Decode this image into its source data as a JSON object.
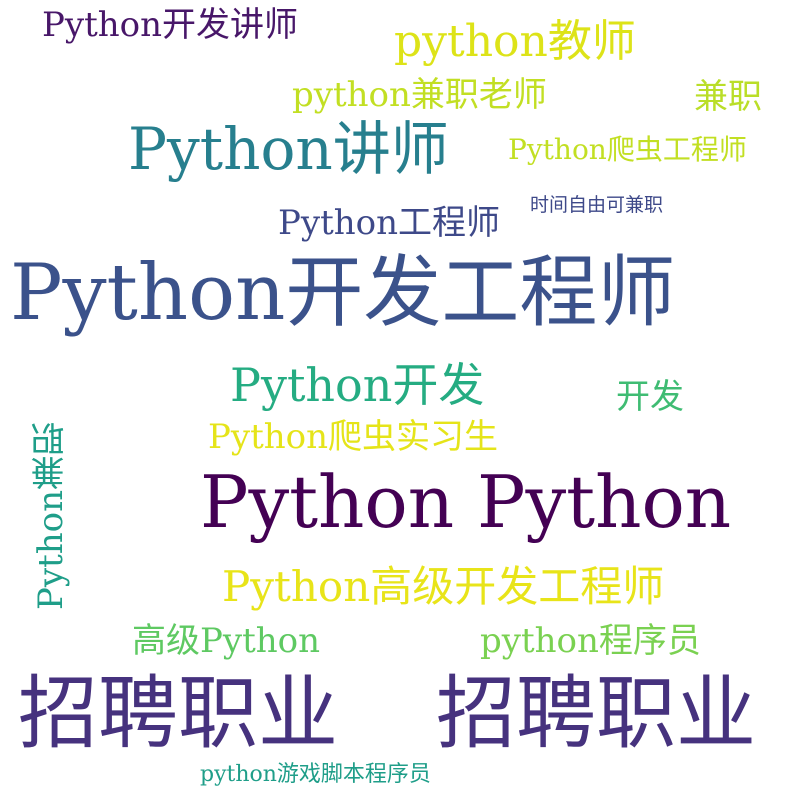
{
  "words": [
    {
      "id": "python-python",
      "text": "Python Python",
      "color": "#440154"
    },
    {
      "id": "python-dev-engineer",
      "text": "Python开发工程师",
      "color": "#3b528b"
    },
    {
      "id": "recruit-1",
      "text": "招聘职业",
      "color": "#46327e"
    },
    {
      "id": "recruit-2",
      "text": "招聘职业",
      "color": "#46327e"
    },
    {
      "id": "python-lecturer",
      "text": "Python讲师",
      "color": "#277f8e"
    },
    {
      "id": "python-teacher",
      "text": "python教师",
      "color": "#dde318"
    },
    {
      "id": "python-dev-lecturer",
      "text": "Python开发讲师",
      "color": "#481769"
    },
    {
      "id": "python-parttime-teacher",
      "text": "python兼职老师",
      "color": "#c2df23"
    },
    {
      "id": "parttime",
      "text": "兼职",
      "color": "#bade28"
    },
    {
      "id": "python-crawler-engineer",
      "text": "Python爬虫工程师",
      "color": "#c2df23"
    },
    {
      "id": "python-engineer",
      "text": "Python工程师",
      "color": "#3e4989"
    },
    {
      "id": "flexible-time",
      "text": "时间自由可兼职",
      "color": "#3e4989"
    },
    {
      "id": "python-dev",
      "text": "Python开发",
      "color": "#25ac82"
    },
    {
      "id": "dev",
      "text": "开发",
      "color": "#3fbc73"
    },
    {
      "id": "python-crawler-intern",
      "text": "Python爬虫实习生",
      "color": "#e5e419"
    },
    {
      "id": "python-parttime",
      "text": "Python兼职",
      "color": "#1f9e89"
    },
    {
      "id": "python-senior-dev-engineer",
      "text": "Python高级开发工程师",
      "color": "#e8e419"
    },
    {
      "id": "senior-python",
      "text": "高级Python",
      "color": "#5ec962"
    },
    {
      "id": "python-programmer",
      "text": "python程序员",
      "color": "#7ad151"
    },
    {
      "id": "python-game-script-programmer",
      "text": "python游戏脚本程序员",
      "color": "#1f9e89"
    }
  ]
}
